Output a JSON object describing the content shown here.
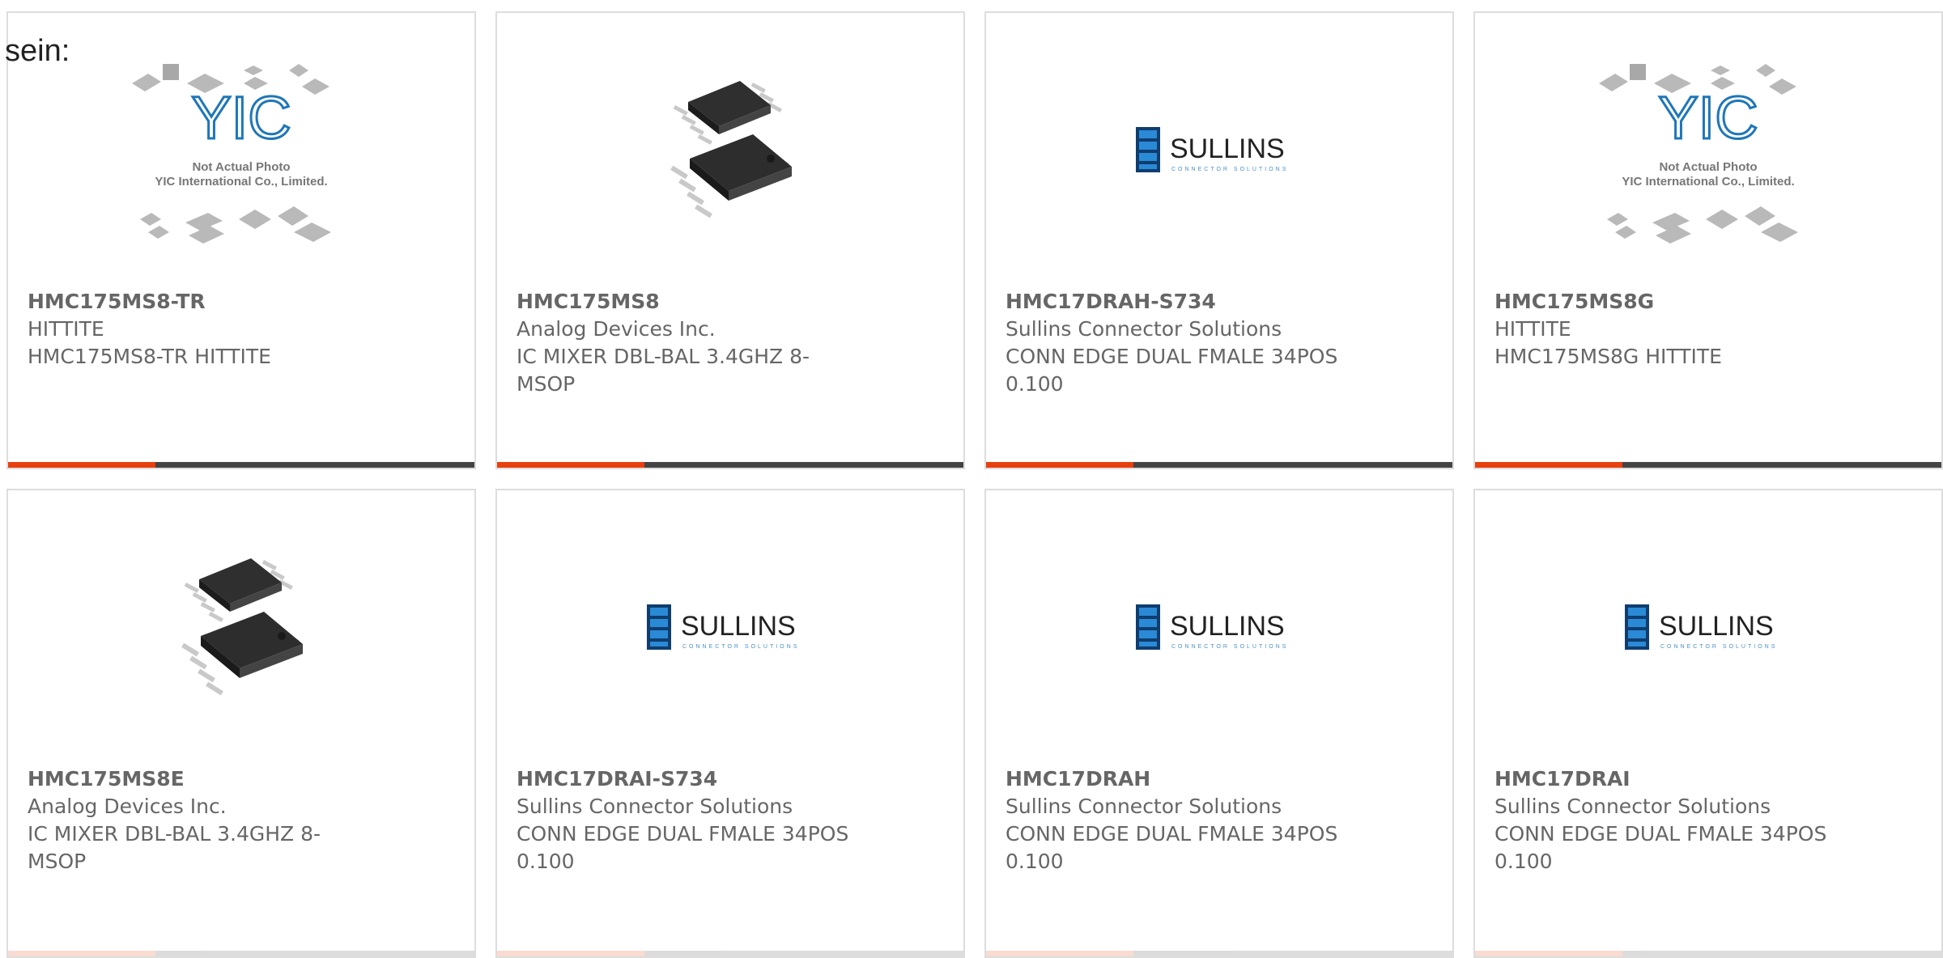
{
  "intro_text": "sein:",
  "colors": {
    "accent": "#e8400e",
    "bar": "#444444",
    "text": "#666666",
    "sullins_blue": "#1f6fb4"
  },
  "placeholder_photo": {
    "brand": "YIC",
    "line1": "Not Actual Photo",
    "line2": "YIC International Co., Limited."
  },
  "sullins_logo": {
    "name": "SULLINS",
    "tagline": "CONNECTOR SOLUTIONS"
  },
  "products": [
    {
      "part": "HMC175MS8-TR",
      "maker": "HITTITE",
      "desc": "HMC175MS8-TR HITTITE",
      "image": "placeholder"
    },
    {
      "part": "HMC175MS8",
      "maker": "Analog Devices Inc.",
      "desc": "IC MIXER DBL-BAL 3.4GHZ 8-MSOP",
      "image": "ic-msop"
    },
    {
      "part": "HMC17DRAH-S734",
      "maker": "Sullins Connector Solutions",
      "desc": "CONN EDGE DUAL FMALE 34POS 0.100",
      "image": "sullins"
    },
    {
      "part": "HMC175MS8G",
      "maker": "HITTITE",
      "desc": "HMC175MS8G HITTITE",
      "image": "placeholder"
    },
    {
      "part": "HMC175MS8E",
      "maker": "Analog Devices Inc.",
      "desc": "IC MIXER DBL-BAL 3.4GHZ 8-MSOP",
      "image": "ic-msop"
    },
    {
      "part": "HMC17DRAI-S734",
      "maker": "Sullins Connector Solutions",
      "desc": "CONN EDGE DUAL FMALE 34POS 0.100",
      "image": "sullins"
    },
    {
      "part": "HMC17DRAH",
      "maker": "Sullins Connector Solutions",
      "desc": "CONN EDGE DUAL FMALE 34POS 0.100",
      "image": "sullins"
    },
    {
      "part": "HMC17DRAI",
      "maker": "Sullins Connector Solutions",
      "desc": "CONN EDGE DUAL FMALE 34POS 0.100",
      "image": "sullins"
    }
  ]
}
